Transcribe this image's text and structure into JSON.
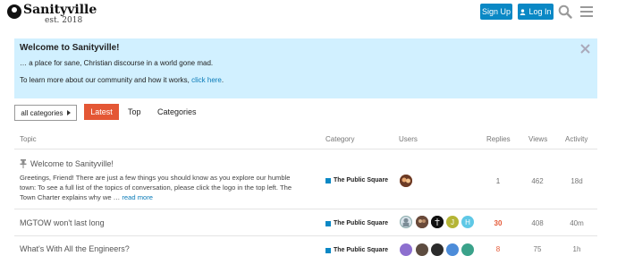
{
  "header": {
    "logo_name": "Sanityville",
    "logo_est": "est. 2018",
    "signup_label": "Sign Up",
    "login_label": "Log In",
    "accent": "#0a88c5"
  },
  "banner": {
    "title": "Welcome to Sanityville!",
    "line1": "… a place for sane, Christian discourse in a world gone mad.",
    "line2_text": "To learn more about our community and how it works, ",
    "line2_link": "click here",
    "line2_end": ".",
    "background": "#d1f0ff"
  },
  "nav": {
    "category_select": "all categories",
    "tabs": [
      {
        "label": "Latest",
        "active": true
      },
      {
        "label": "Top",
        "active": false
      },
      {
        "label": "Categories",
        "active": false
      }
    ],
    "active_color": "#e45735"
  },
  "table": {
    "headers": {
      "topic": "Topic",
      "category": "Category",
      "users": "Users",
      "replies": "Replies",
      "views": "Views",
      "activity": "Activity"
    },
    "rows": [
      {
        "title": "Welcome to Sanityville!",
        "pinned": true,
        "excerpt": "Greetings, Friend! There are just a few things you should know as you explore our humble town: To see a full list of the topics of conversation, please click the logo in the top left. The Town Charter explains why we …",
        "read_more": "read more",
        "category": "The Public Square",
        "replies": "1",
        "views": "462",
        "activity": "18d"
      },
      {
        "title": "MGTOW won't last long",
        "pinned": false,
        "category": "The Public Square",
        "avatar_letters": [
          "J",
          "H"
        ],
        "replies": "30",
        "views": "408",
        "activity": "40m"
      },
      {
        "title": "What's With All the Engineers?",
        "pinned": false,
        "category": "The Public Square",
        "replies": "8",
        "views": "75",
        "activity": "1h"
      }
    ]
  }
}
